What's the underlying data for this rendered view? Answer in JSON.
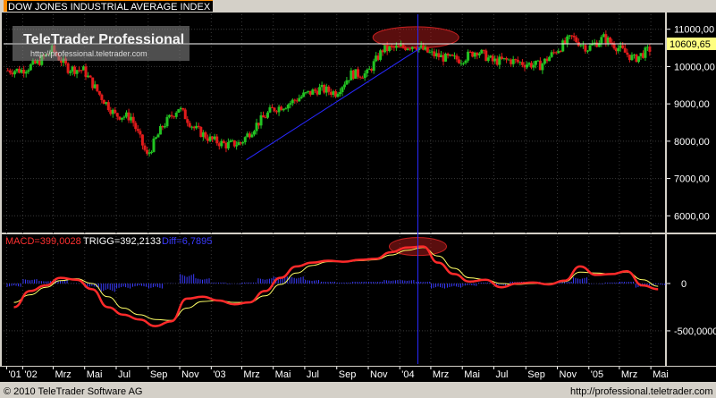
{
  "window": {
    "title": "DOW JONES INDUSTRIAL AVERAGE INDEX",
    "watermark_title": "TeleTrader Professional",
    "watermark_url": "http://professional.teletrader.com"
  },
  "footer": {
    "copyright": "© 2010 TeleTrader Software AG",
    "url": "http://professional.teletrader.com"
  },
  "colors": {
    "background": "#000000",
    "frame": "#d4d0c8",
    "candle_up": "#22c322",
    "candle_down": "#e11b1b",
    "grid": "#3a3a3a",
    "macd": "#ff2a2a",
    "trigger": "#ffff66",
    "diff": "#3a3aff",
    "trendline": "#2828ff",
    "highlight_ellipse": "#c82020",
    "current_price_line": "#ffffff",
    "price_tag_bg": "#ffff80"
  },
  "chart_data": [
    {
      "type": "candlestick",
      "title": "DOW JONES INDUSTRIAL AVERAGE INDEX",
      "x_tick_labels": [
        "'01",
        "'02",
        "Mrz",
        "Mai",
        "Jul",
        "Sep",
        "Nov",
        "'03",
        "Mrz",
        "Mai",
        "Jul",
        "Sep",
        "Nov",
        "'04",
        "Mrz",
        "Mai",
        "Jul",
        "Sep",
        "Nov",
        "'05",
        "Mrz",
        "Mai"
      ],
      "y_tick_labels": [
        "11000,00",
        "10000,00",
        "9000,00",
        "8000,00",
        "7000,00",
        "6000,00"
      ],
      "y_ticks": [
        11000,
        10000,
        9000,
        8000,
        7000,
        6000
      ],
      "ylim": [
        5600,
        11400
      ],
      "current_value": 10609.65,
      "current_value_label": "10609,65",
      "grid": true,
      "annotations": [
        "trendline Mar 2003 to Feb 2004",
        "ellipse around Jan–Mar 2004 peak",
        "vertical marker line at early Feb 2004"
      ],
      "monthly_close": [
        {
          "date": "2001-12",
          "value": 9900
        },
        {
          "date": "2002-01",
          "value": 9900
        },
        {
          "date": "2002-02",
          "value": 10100
        },
        {
          "date": "2002-03",
          "value": 10450
        },
        {
          "date": "2002-04",
          "value": 9950
        },
        {
          "date": "2002-05",
          "value": 9900
        },
        {
          "date": "2002-06",
          "value": 9250
        },
        {
          "date": "2002-07",
          "value": 8700
        },
        {
          "date": "2002-08",
          "value": 8650
        },
        {
          "date": "2002-09",
          "value": 7600
        },
        {
          "date": "2002-10",
          "value": 8400
        },
        {
          "date": "2002-11",
          "value": 8900
        },
        {
          "date": "2002-12",
          "value": 8350
        },
        {
          "date": "2003-01",
          "value": 8050
        },
        {
          "date": "2003-02",
          "value": 7900
        },
        {
          "date": "2003-03",
          "value": 7950
        },
        {
          "date": "2003-04",
          "value": 8450
        },
        {
          "date": "2003-05",
          "value": 8850
        },
        {
          "date": "2003-06",
          "value": 9000
        },
        {
          "date": "2003-07",
          "value": 9230
        },
        {
          "date": "2003-08",
          "value": 9400
        },
        {
          "date": "2003-09",
          "value": 9300
        },
        {
          "date": "2003-10",
          "value": 9800
        },
        {
          "date": "2003-11",
          "value": 9800
        },
        {
          "date": "2003-12",
          "value": 10450
        },
        {
          "date": "2004-01",
          "value": 10500
        },
        {
          "date": "2004-02",
          "value": 10580
        },
        {
          "date": "2004-03",
          "value": 10350
        },
        {
          "date": "2004-04",
          "value": 10220
        },
        {
          "date": "2004-05",
          "value": 10190
        },
        {
          "date": "2004-06",
          "value": 10430
        },
        {
          "date": "2004-07",
          "value": 10140
        },
        {
          "date": "2004-08",
          "value": 10170
        },
        {
          "date": "2004-09",
          "value": 10080
        },
        {
          "date": "2004-10",
          "value": 10030
        },
        {
          "date": "2004-11",
          "value": 10430
        },
        {
          "date": "2004-12",
          "value": 10780
        },
        {
          "date": "2005-01",
          "value": 10490
        },
        {
          "date": "2005-02",
          "value": 10770
        },
        {
          "date": "2005-03",
          "value": 10500
        },
        {
          "date": "2005-04",
          "value": 10200
        },
        {
          "date": "2005-05",
          "value": 10460
        }
      ]
    },
    {
      "type": "line",
      "indicator_labels": {
        "macd": "MACD=399,0028",
        "trigg": "TRIGG=392,2133",
        "diff": "Diff=6,7895"
      },
      "y_tick_labels": [
        "0",
        "-500,0000"
      ],
      "y_ticks": [
        0,
        -500
      ],
      "ylim": [
        -850,
        500
      ],
      "series": [
        {
          "name": "MACD",
          "values": [
            {
              "date": "2001-12",
              "value": -250
            },
            {
              "date": "2002-01",
              "value": -80
            },
            {
              "date": "2002-02",
              "value": -20
            },
            {
              "date": "2002-03",
              "value": 60
            },
            {
              "date": "2002-04",
              "value": 40
            },
            {
              "date": "2002-05",
              "value": -60
            },
            {
              "date": "2002-06",
              "value": -250
            },
            {
              "date": "2002-07",
              "value": -330
            },
            {
              "date": "2002-08",
              "value": -380
            },
            {
              "date": "2002-09",
              "value": -450
            },
            {
              "date": "2002-10",
              "value": -400
            },
            {
              "date": "2002-11",
              "value": -160
            },
            {
              "date": "2002-12",
              "value": -140
            },
            {
              "date": "2003-01",
              "value": -180
            },
            {
              "date": "2003-02",
              "value": -220
            },
            {
              "date": "2003-03",
              "value": -200
            },
            {
              "date": "2003-04",
              "value": -80
            },
            {
              "date": "2003-05",
              "value": 60
            },
            {
              "date": "2003-06",
              "value": 180
            },
            {
              "date": "2003-07",
              "value": 220
            },
            {
              "date": "2003-08",
              "value": 240
            },
            {
              "date": "2003-09",
              "value": 230
            },
            {
              "date": "2003-10",
              "value": 250
            },
            {
              "date": "2003-11",
              "value": 260
            },
            {
              "date": "2003-12",
              "value": 330
            },
            {
              "date": "2004-01",
              "value": 380
            },
            {
              "date": "2004-02",
              "value": 390
            },
            {
              "date": "2004-03",
              "value": 220
            },
            {
              "date": "2004-04",
              "value": 100
            },
            {
              "date": "2004-05",
              "value": 20
            },
            {
              "date": "2004-06",
              "value": 40
            },
            {
              "date": "2004-07",
              "value": -40
            },
            {
              "date": "2004-08",
              "value": 0
            },
            {
              "date": "2004-09",
              "value": 10
            },
            {
              "date": "2004-10",
              "value": -10
            },
            {
              "date": "2004-11",
              "value": 30
            },
            {
              "date": "2004-12",
              "value": 180
            },
            {
              "date": "2005-01",
              "value": 90
            },
            {
              "date": "2005-02",
              "value": 100
            },
            {
              "date": "2005-03",
              "value": 130
            },
            {
              "date": "2005-04",
              "value": -20
            },
            {
              "date": "2005-05",
              "value": -60
            }
          ]
        },
        {
          "name": "TRIGG",
          "values": [
            {
              "date": "2001-12",
              "value": -200
            },
            {
              "date": "2002-01",
              "value": -120
            },
            {
              "date": "2002-02",
              "value": -40
            },
            {
              "date": "2002-03",
              "value": 30
            },
            {
              "date": "2002-04",
              "value": 50
            },
            {
              "date": "2002-05",
              "value": 0
            },
            {
              "date": "2002-06",
              "value": -140
            },
            {
              "date": "2002-07",
              "value": -260
            },
            {
              "date": "2002-08",
              "value": -330
            },
            {
              "date": "2002-09",
              "value": -380
            },
            {
              "date": "2002-10",
              "value": -390
            },
            {
              "date": "2002-11",
              "value": -260
            },
            {
              "date": "2002-12",
              "value": -190
            },
            {
              "date": "2003-01",
              "value": -180
            },
            {
              "date": "2003-02",
              "value": -200
            },
            {
              "date": "2003-03",
              "value": -200
            },
            {
              "date": "2003-04",
              "value": -130
            },
            {
              "date": "2003-05",
              "value": -10
            },
            {
              "date": "2003-06",
              "value": 110
            },
            {
              "date": "2003-07",
              "value": 190
            },
            {
              "date": "2003-08",
              "value": 230
            },
            {
              "date": "2003-09",
              "value": 230
            },
            {
              "date": "2003-10",
              "value": 240
            },
            {
              "date": "2003-11",
              "value": 250
            },
            {
              "date": "2003-12",
              "value": 300
            },
            {
              "date": "2004-01",
              "value": 350
            },
            {
              "date": "2004-02",
              "value": 380
            },
            {
              "date": "2004-03",
              "value": 290
            },
            {
              "date": "2004-04",
              "value": 160
            },
            {
              "date": "2004-05",
              "value": 60
            },
            {
              "date": "2004-06",
              "value": 40
            },
            {
              "date": "2004-07",
              "value": 0
            },
            {
              "date": "2004-08",
              "value": -10
            },
            {
              "date": "2004-09",
              "value": 0
            },
            {
              "date": "2004-10",
              "value": 0
            },
            {
              "date": "2004-11",
              "value": 20
            },
            {
              "date": "2004-12",
              "value": 120
            },
            {
              "date": "2005-01",
              "value": 110
            },
            {
              "date": "2005-02",
              "value": 100
            },
            {
              "date": "2005-03",
              "value": 120
            },
            {
              "date": "2005-04",
              "value": 40
            },
            {
              "date": "2005-05",
              "value": -30
            }
          ]
        }
      ]
    }
  ]
}
